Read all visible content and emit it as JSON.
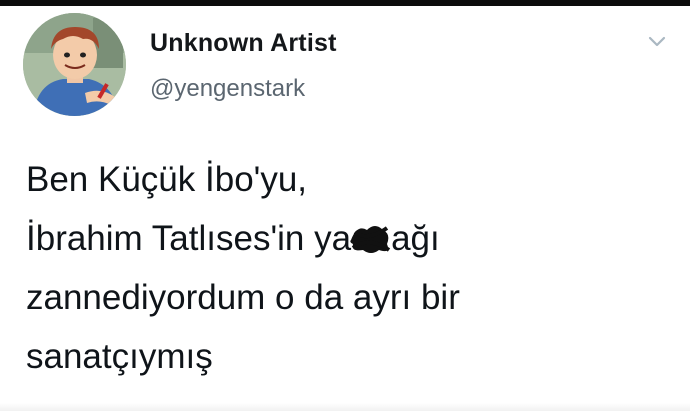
{
  "author": {
    "display_name": "Unknown Artist",
    "handle": "@yengenstark"
  },
  "icons": {
    "avatar": "cartoon-avatar",
    "menu": "chevron-down-icon",
    "redaction": "scribble-redaction"
  },
  "tweet": {
    "line1": "Ben Küçük İbo'yu,",
    "line2_before": "İbrahim Tatlıses'in ya",
    "line2_after": "ağı",
    "line3": "zannediyordum o da ayrı bir",
    "line4": "sanatçıymış"
  },
  "colors": {
    "text": "#0f1419",
    "secondary_text": "#5b6670",
    "caret": "#aab8c2",
    "top_strip": "#0c0c0c"
  }
}
